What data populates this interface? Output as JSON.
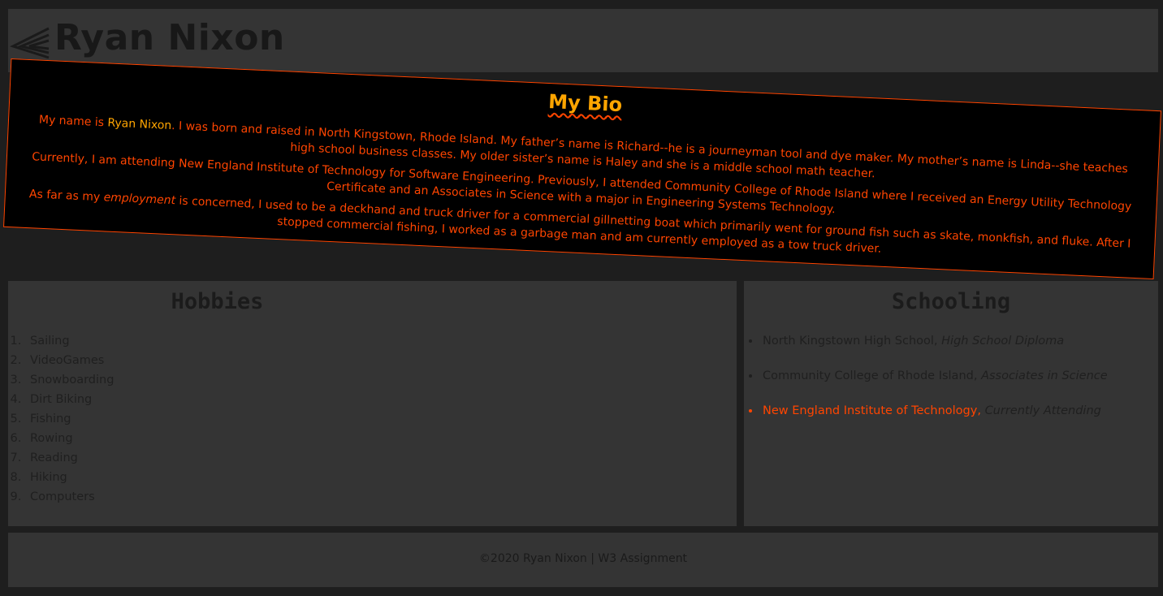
{
  "header": {
    "title": "Ryan Nixon",
    "logo_icon": "triple-chevron-left-icon"
  },
  "bio": {
    "title": "My Bio",
    "p1_before_name": "My name is ",
    "p1_name": "Ryan Nixon",
    "p1_after_name": ". I was born and raised in North Kingstown, Rhode Island. My father’s name is Richard--he is a journeyman tool and dye maker. My mother’s name is Linda--she teaches high school business classes. My older sister’s name is Haley and she is a middle school math teacher.",
    "p2": "Currently, I am attending New England Institute of Technology for Software Engineering. Previously, I attended Community College of Rhode Island where I received an Energy Utility Technology Certificate and an Associates in Science with a major in Engineering Systems Technology.",
    "p3_before_em": "As far as my ",
    "p3_em": "employment",
    "p3_after_em": " is concerned, I used to be a deckhand and truck driver for a commercial gillnetting boat which primarily went for ground fish such as skate, monkfish, and fluke. After I stopped commercial fishing, I worked as a garbage man and am currently employed as a tow truck driver."
  },
  "hobbies": {
    "title": "Hobbies",
    "items": [
      "Sailing",
      "VideoGames",
      "Snowboarding",
      "Dirt Biking",
      "Fishing",
      "Rowing",
      "Reading",
      "Hiking",
      "Computers"
    ]
  },
  "schooling": {
    "title": "Schooling",
    "items": [
      {
        "school": "North Kingstown High School,",
        "degree": "High School Diploma"
      },
      {
        "school": "Community College of Rhode Island,",
        "degree": "Associates in Science"
      },
      {
        "school": "New England Institute of Technology,",
        "degree": "Currently Attending"
      }
    ]
  },
  "footer": {
    "copyright": "©2020 Ryan Nixon | W3 Assignment"
  },
  "colors": {
    "page_background": "#1e1e1e",
    "panel_background": "#343434",
    "bio_background": "#000000",
    "accent_orange_red": "#ff4500",
    "accent_orange": "#ffa500"
  }
}
